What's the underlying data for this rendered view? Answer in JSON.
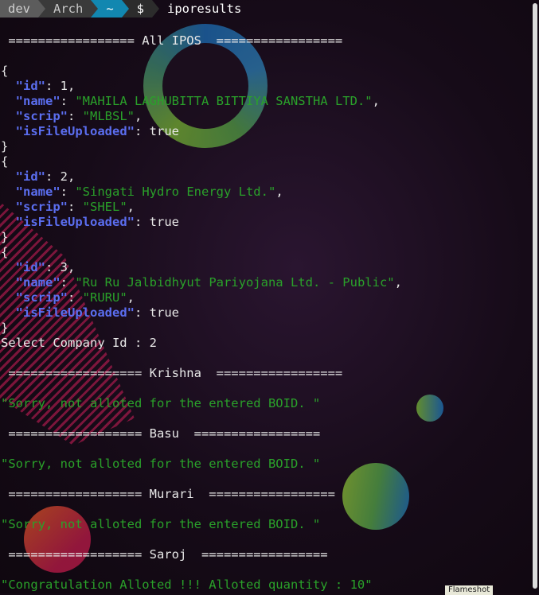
{
  "prompt": {
    "user": "dev",
    "host": "Arch",
    "dir": "~",
    "symbol": "$",
    "command": "iporesults"
  },
  "header_all_ipos": " ================= All IPOS  =================",
  "ipos": [
    {
      "id": "1",
      "name": "\"MAHILA LAGHUBITTA BITTIYA SANSTHA LTD.\"",
      "scrip": "\"MLBSL\"",
      "isFileUploaded": "true"
    },
    {
      "id": "2",
      "name": "\"Singati Hydro Energy Ltd.\"",
      "scrip": "\"SHEL\"",
      "isFileUploaded": "true"
    },
    {
      "id": "3",
      "name": "\"Ru Ru Jalbidhyut Pariyojana Ltd. - Public\"",
      "scrip": "\"RURU\"",
      "isFileUploaded": "true"
    }
  ],
  "json_keys": {
    "id": "\"id\"",
    "name": "\"name\"",
    "scrip": "\"scrip\"",
    "isFileUploaded": "\"isFileUploaded\""
  },
  "select_prompt": "Select Company Id : 2",
  "results": [
    {
      "header": " ================== Krishna  =================",
      "message": "\"Sorry, not alloted for the entered BOID. \""
    },
    {
      "header": " ================== Basu  =================",
      "message": "\"Sorry, not alloted for the entered BOID. \""
    },
    {
      "header": " ================== Murari  =================",
      "message": "\"Sorry, not alloted for the entered BOID. \""
    },
    {
      "header": " ================== Saroj  =================",
      "message": "\"Congratulation Alloted !!! Alloted quantity : 10\""
    }
  ],
  "overlay_badge": "Flameshot"
}
